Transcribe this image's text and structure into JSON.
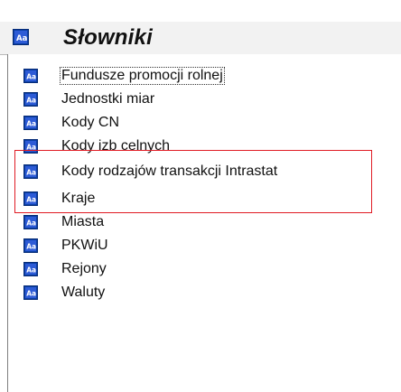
{
  "header": {
    "title": "Słowniki",
    "icon": "dictionary-icon"
  },
  "tree": {
    "items": [
      {
        "label": "Fundusze promocji rolnej",
        "icon": "dictionary-icon",
        "focused": true
      },
      {
        "label": "Jednostki miar",
        "icon": "dictionary-icon"
      },
      {
        "label": "Kody CN",
        "icon": "dictionary-icon"
      },
      {
        "label": "Kody izb celnych",
        "icon": "dictionary-icon",
        "highlighted": true
      },
      {
        "label": "Kody rodzajów transakcji Intrastat",
        "icon": "dictionary-icon",
        "highlighted": true
      },
      {
        "label": "Kraje",
        "icon": "dictionary-icon"
      },
      {
        "label": "Miasta",
        "icon": "dictionary-icon"
      },
      {
        "label": "PKWiU",
        "icon": "dictionary-icon"
      },
      {
        "label": "Rejony",
        "icon": "dictionary-icon"
      },
      {
        "label": "Waluty",
        "icon": "dictionary-icon"
      }
    ]
  },
  "colors": {
    "icon_blue": "#0b3fa6",
    "icon_light": "#ffffff",
    "highlight_red": "#e01b24",
    "header_bg": "#f2f2f2"
  }
}
